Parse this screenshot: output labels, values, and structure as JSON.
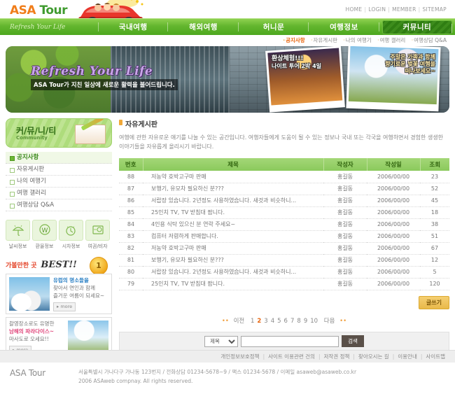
{
  "header": {
    "logo_asa": "ASA",
    "logo_tour": "Tour",
    "car_icon": "red-convertible-car-icon",
    "toplinks": [
      "HOME",
      "LOGIN",
      "MEMBER",
      "SITEMAP"
    ]
  },
  "nav": {
    "slogan": "Refresh Your Life",
    "items": [
      {
        "label": "국내여행",
        "active": false
      },
      {
        "label": "해외여행",
        "active": false
      },
      {
        "label": "허니문",
        "active": false
      },
      {
        "label": "여행정보",
        "active": false
      },
      {
        "label": "커뮤니티",
        "active": true
      }
    ]
  },
  "subnav": {
    "items": [
      {
        "label": "공지사항",
        "active": true
      },
      {
        "label": "자유게시판",
        "active": false
      },
      {
        "label": "나의 여행기",
        "active": false
      },
      {
        "label": "여행 갤러리",
        "active": false
      },
      {
        "label": "여행상담 Q&A",
        "active": false
      }
    ]
  },
  "hero": {
    "title": "Refresh Your Life",
    "subtitle": "ASA Tour가 지친 일상에 새로운 활력을 불어드립니다.",
    "photo1_line1": "환상체험!!!",
    "photo1_line2": "나이트 투어 2박 4일",
    "photo2_line1": "주말은 가족과 함께",
    "photo2_line2": "향기로운 벚꽃 여행을",
    "photo2_line3": "떠나보세요~"
  },
  "sidebar": {
    "box_title_ko": "커/뮤/니/티",
    "box_title_en": "Community",
    "menu": [
      {
        "label": "공지사항",
        "active": true
      },
      {
        "label": "자유게시판",
        "active": false
      },
      {
        "label": "나의 여행기",
        "active": false
      },
      {
        "label": "여행 갤러리",
        "active": false
      },
      {
        "label": "여행상담 Q&A",
        "active": false
      }
    ],
    "icons": [
      {
        "label": "날씨정보",
        "icon": "umbrella-rain-icon",
        "glyph": "☂"
      },
      {
        "label": "환율정보",
        "icon": "won-currency-icon",
        "glyph": "₩"
      },
      {
        "label": "시차정보",
        "icon": "alarm-clock-icon",
        "glyph": "⏰"
      },
      {
        "label": "여권/비자",
        "icon": "passport-card-icon",
        "glyph": "🪪"
      }
    ],
    "best_title_ko": "가볼만한 곳",
    "best_title_en": "BEST!!",
    "medal_number": "1",
    "promo1": {
      "highlight": "유럽의 명소들을",
      "line2": "찾아서 연인과 함께",
      "line3": "즐거운 여름이 되세요~",
      "more": "more"
    },
    "promo2": {
      "line1": "촬영장소로도 유명한",
      "highlight": "남해의 파라다이스~",
      "line3": "마사도로 오세요!!",
      "more": "more"
    }
  },
  "content": {
    "title": "자유게시판",
    "description": "여행에 관한 자유로운 얘기를 나눌 수 있는 공간입니다. 여행자들에게 도움이 될 수 있는 정보나 국내 또는 각국을 여행하면서 경험한 생생한 이야기들을 자유롭게 올리시기 바랍니다.",
    "table": {
      "headers": [
        "번호",
        "제목",
        "작성자",
        "작성일",
        "조회"
      ],
      "rows": [
        {
          "no": "88",
          "subject": "저농약 호박고구마 판매",
          "writer": "홍길동",
          "date": "2006/00/00",
          "hit": "23"
        },
        {
          "no": "87",
          "subject": "보행기, 유모차 필요하신 분???",
          "writer": "홍길동",
          "date": "2006/00/00",
          "hit": "52"
        },
        {
          "no": "86",
          "subject": "서랍장 있습니다. 2년정도 사용하였습니다. 새것과 비슷하니...",
          "writer": "홍길동",
          "date": "2006/00/00",
          "hit": "45"
        },
        {
          "no": "85",
          "subject": "25인치 TV, TV 받침대 팝니다.",
          "writer": "홍길동",
          "date": "2006/00/00",
          "hit": "18"
        },
        {
          "no": "84",
          "subject": "4인용 식탁 있으신 분 연락 주세요~",
          "writer": "홍길동",
          "date": "2006/00/00",
          "hit": "38"
        },
        {
          "no": "83",
          "subject": "컴퓨터 저렴하게 판매합니다.",
          "writer": "홍길동",
          "date": "2006/00/00",
          "hit": "51"
        },
        {
          "no": "82",
          "subject": "저농약 호박고구마 판매",
          "writer": "홍길동",
          "date": "2006/00/00",
          "hit": "67"
        },
        {
          "no": "81",
          "subject": "보행기, 유모차 필요하신 분???",
          "writer": "홍길동",
          "date": "2006/00/00",
          "hit": "12"
        },
        {
          "no": "80",
          "subject": "서랍장 있습니다. 2년정도 사용하였습니다. 새것과 비슷하니...",
          "writer": "홍길동",
          "date": "2006/00/00",
          "hit": "5"
        },
        {
          "no": "79",
          "subject": "25인치 TV, TV 받침대 팝니다.",
          "writer": "홍길동",
          "date": "2006/00/00",
          "hit": "120"
        }
      ]
    },
    "write_button": "글쓰기",
    "paging": {
      "prev": "이전",
      "next": "다음",
      "pages": [
        "1",
        "2",
        "3",
        "4",
        "5",
        "6",
        "7",
        "8",
        "9",
        "10"
      ],
      "current": "2"
    },
    "search": {
      "select_value": "제목",
      "input_value": "",
      "input_placeholder": "",
      "button": "검색"
    }
  },
  "footer": {
    "links": [
      "개인정보보호정책",
      "사이트 이용관련 건의",
      "저작권 정책",
      "찾아오시는 길",
      "이용안내",
      "사이트맵"
    ],
    "logo": "ASA Tour",
    "address": "서울특별시 가나다구 가나동 123번지  /  전화상담 01234-5678~9  /  팩스 01234-5678  /  이메일  asaweb@asaweb.co.kr",
    "copyright": "2006 ASAweb compnay. All rights reserved."
  },
  "colors": {
    "brand_orange": "#f07d1a",
    "brand_green": "#3f9b2f",
    "nav_green": "#63b52e",
    "table_header": "#8bc95c",
    "accent_amber": "#e9b94a"
  }
}
